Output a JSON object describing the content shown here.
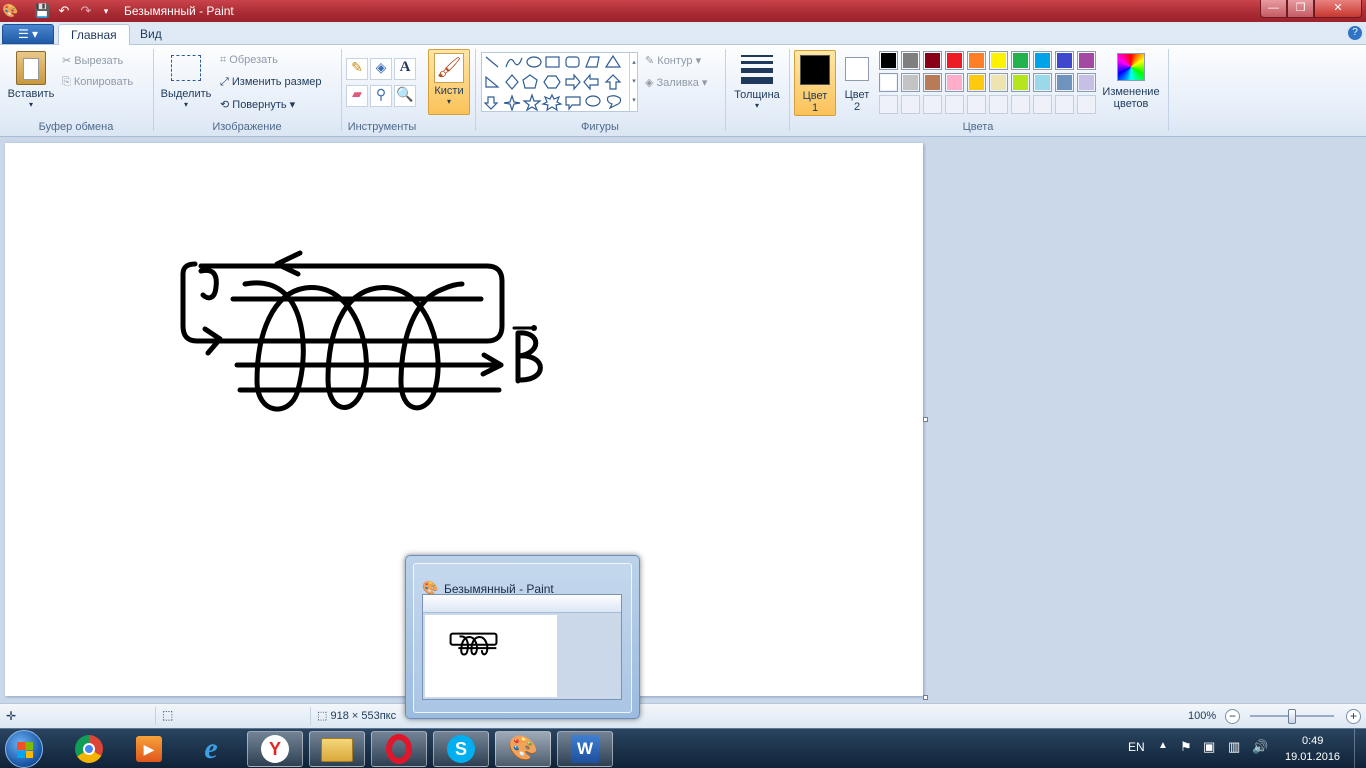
{
  "window": {
    "title": "Безымянный - Paint",
    "minimize": "—",
    "maximize": "❐",
    "close": "✕"
  },
  "quick_access": [
    "save-icon",
    "undo-icon",
    "redo-icon",
    "customize-icon"
  ],
  "tabs": [
    {
      "label": "Главная",
      "active": true
    },
    {
      "label": "Вид",
      "active": false
    }
  ],
  "ribbon": {
    "clipboard": {
      "paste": "Вставить",
      "cut": "Вырезать",
      "copy": "Копировать",
      "group": "Буфер обмена"
    },
    "image": {
      "select": "Выделить",
      "crop": "Обрезать",
      "resize": "Изменить размер",
      "rotate": "Повернуть",
      "group": "Изображение"
    },
    "tools": {
      "group": "Инструменты"
    },
    "brushes": {
      "label": "Кисти"
    },
    "shapes": {
      "outline": "Контур",
      "fill": "Заливка",
      "group": "Фигуры"
    },
    "size": {
      "label": "Толщина"
    },
    "colors": {
      "color1_a": "Цвет",
      "color1_b": "1",
      "color2_a": "Цвет",
      "color2_b": "2",
      "edit_a": "Изменение",
      "edit_b": "цветов",
      "group": "Цвета",
      "color1_value": "#000000",
      "color2_value": "#ffffff",
      "palette_row1": [
        "#000000",
        "#7f7f7f",
        "#880015",
        "#ed1c24",
        "#ff7f27",
        "#fff200",
        "#22b14c",
        "#00a2e8",
        "#3f48cc",
        "#a349a4"
      ],
      "palette_row2": [
        "#ffffff",
        "#c3c3c3",
        "#b97a57",
        "#ffaec9",
        "#ffc90e",
        "#efe4b0",
        "#b5e61d",
        "#99d9ea",
        "#7092be",
        "#c8bfe7"
      ]
    }
  },
  "canvas": {
    "label_i": "J",
    "label_b": "B"
  },
  "status": {
    "size": "918 × 553пкс",
    "zoom": "100%",
    "zoom_out": "−",
    "zoom_in": "+"
  },
  "preview": {
    "title": "Безымянный - Paint"
  },
  "tray": {
    "lang": "EN",
    "time": "0:49",
    "date": "19.01.2016"
  }
}
